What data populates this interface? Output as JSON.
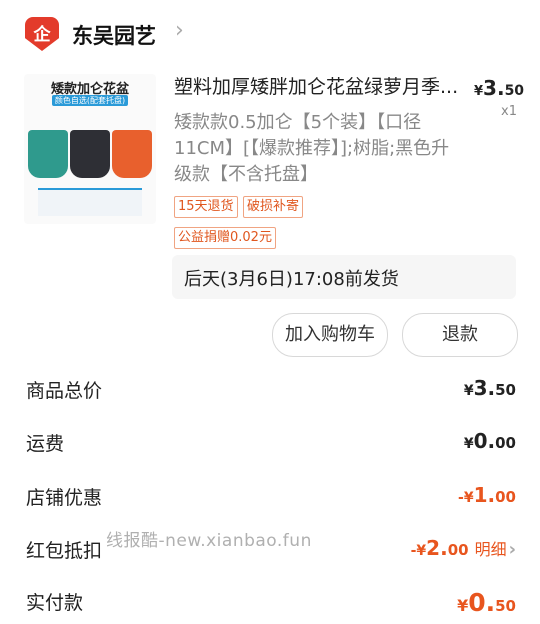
{
  "store": {
    "icon_glyph": "企",
    "name": "东吴园艺",
    "chevron": "›"
  },
  "thumbnail": {
    "title": "矮款加仑花盆",
    "subtitle": "颜色自选(配套托盘)"
  },
  "product": {
    "title": "塑料加厚矮胖加仑花盆绿萝月季...",
    "price_symbol": "¥",
    "price_int": "3.",
    "price_dec": "50",
    "quantity": "x1",
    "spec": "矮款款0.5加仑【5个装】【口径11CM】[【爆款推荐】];树脂;黑色升级款【不含托盘】",
    "tags": [
      "15天退货",
      "破损补寄",
      "公益捐赠0.02元"
    ],
    "shipping": "后天(3月6日)17:08前发货"
  },
  "buttons": {
    "add_to_cart": "加入购物车",
    "refund": "退款"
  },
  "summary": {
    "goods_total_label": "商品总价",
    "goods_total_sym": "¥",
    "goods_total_int": "3.",
    "goods_total_dec": "50",
    "shipping_label": "运费",
    "shipping_sym": "¥",
    "shipping_int": "0.",
    "shipping_dec": "00",
    "store_discount_label": "店铺优惠",
    "store_discount_sym": "-¥",
    "store_discount_int": "1.",
    "store_discount_dec": "00",
    "redpacket_label": "红包抵扣",
    "redpacket_sym": "-¥",
    "redpacket_int": "2.",
    "redpacket_dec": "00",
    "redpacket_detail": "明细",
    "redpacket_chevron": "›",
    "paid_label": "实付款",
    "paid_sym": "¥",
    "paid_int": "0.",
    "paid_dec": "50"
  },
  "watermark": "线报酷-new.xianbao.fun",
  "colors": {
    "accent_red": "#e8551e",
    "store_icon": "#e33b2b"
  }
}
